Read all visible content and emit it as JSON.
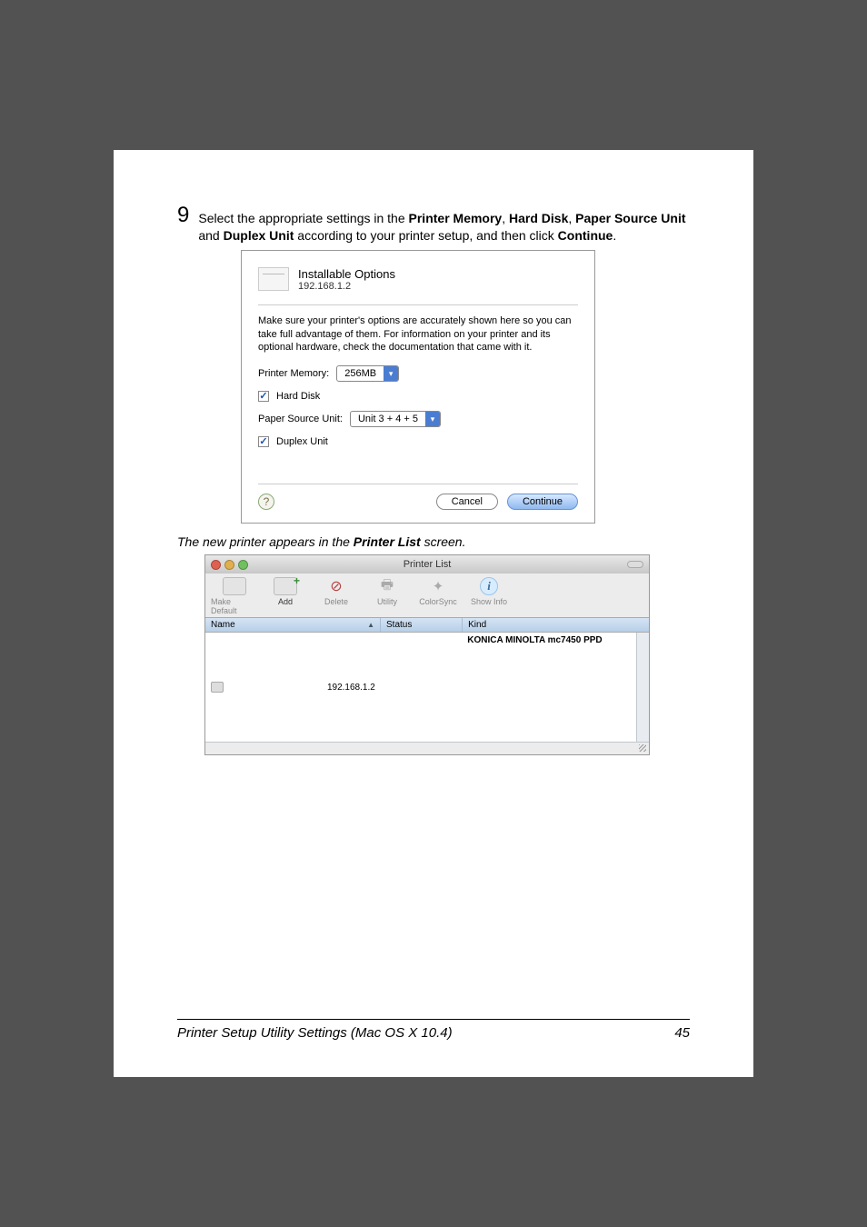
{
  "step": {
    "number": "9",
    "text_parts": [
      "Select the appropriate settings in the ",
      "Printer Memory",
      ", ",
      "Hard Disk",
      ", ",
      "Paper Source Unit",
      " and ",
      "Duplex Unit",
      " according to your printer setup, and then click ",
      "Continue",
      "."
    ]
  },
  "dialog": {
    "title": "Installable Options",
    "subtitle": "192.168.1.2",
    "note": "Make sure your printer's options are accurately shown here so you can take full advantage of them.  For information on your printer and its optional hardware, check the documentation that came with it.",
    "printer_memory_label": "Printer Memory:",
    "printer_memory_value": "256MB",
    "hard_disk_label": "Hard Disk",
    "paper_source_label": "Paper Source Unit:",
    "paper_source_value": "Unit 3 + 4 + 5",
    "duplex_label": "Duplex Unit",
    "help": "?",
    "cancel": "Cancel",
    "continue": "Continue"
  },
  "caption_parts": [
    "The new printer appears in the ",
    "Printer List",
    " screen."
  ],
  "printer_list": {
    "window_title": "Printer List",
    "toolbar": {
      "make_default": "Make Default",
      "add": "Add",
      "delete": "Delete",
      "utility": "Utility",
      "colorsync": "ColorSync",
      "show_info": "Show Info"
    },
    "columns": {
      "name": "Name",
      "status": "Status",
      "kind": "Kind"
    },
    "rows": [
      {
        "name": "192.168.1.2",
        "status": "",
        "kind": "KONICA MINOLTA mc7450 PPD"
      }
    ]
  },
  "footer": {
    "title": "Printer Setup Utility Settings (Mac OS X 10.4)",
    "page": "45"
  }
}
